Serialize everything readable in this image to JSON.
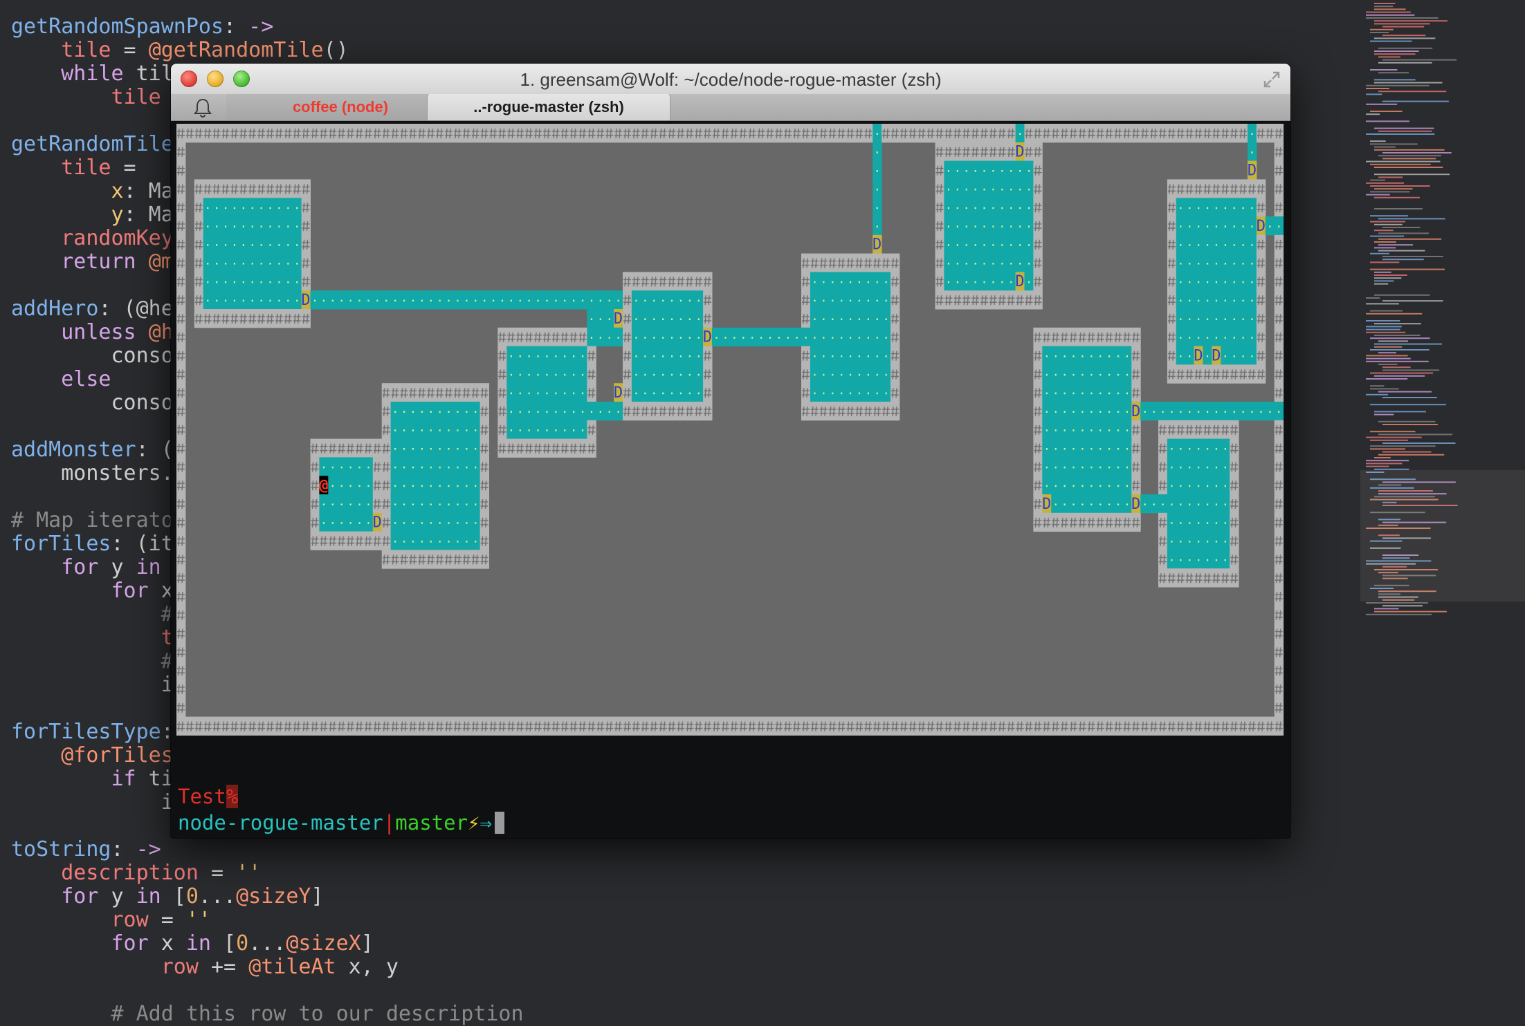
{
  "window": {
    "title": "1. greensam@Wolf: ~/code/node-rogue-master (zsh)",
    "tabs": [
      {
        "label": "coffee (node)",
        "state": "alert"
      },
      {
        "label": "..-rogue-master (zsh)",
        "state": "active"
      }
    ]
  },
  "map": {
    "wall_glyph": "#",
    "floor_glyph": ".",
    "door_glyph": "D",
    "hero_glyph": "@",
    "colors": {
      "floor": "#12a8a7",
      "wall": "#b5b5b5",
      "void": "#686868",
      "door": "#2b3fd0",
      "door_bg": "#c7b23a",
      "hero": "#ff3322",
      "hero_bg": "#000000",
      "dots": "#c6f39a"
    }
  },
  "terminal": {
    "output_line": "Test",
    "output_marker": "%",
    "prompt_dir": "node-rogue-master",
    "prompt_sep": "|",
    "prompt_branch": "master",
    "prompt_bolt": "⚡",
    "prompt_arrow": "⇒"
  },
  "editor": {
    "lines": [
      [
        [
          "fn",
          "getRandomSpawnPos"
        ],
        [
          "plain",
          ": "
        ],
        [
          "kw",
          "->"
        ]
      ],
      [
        [
          "plain",
          "    "
        ],
        [
          "var",
          "tile"
        ],
        [
          "plain",
          " = "
        ],
        [
          "at",
          "@getRandomTile"
        ],
        [
          "plain",
          "()"
        ]
      ],
      [
        [
          "plain",
          "    "
        ],
        [
          "kw",
          "while"
        ],
        [
          "plain",
          " tile"
        ]
      ],
      [
        [
          "plain",
          "        "
        ],
        [
          "var",
          "tile"
        ],
        [
          "plain",
          " ="
        ]
      ],
      [],
      [
        [
          "fn",
          "getRandomTile"
        ],
        [
          "plain",
          ":"
        ]
      ],
      [
        [
          "plain",
          "    "
        ],
        [
          "var",
          "tile"
        ],
        [
          "plain",
          " ="
        ]
      ],
      [
        [
          "plain",
          "        "
        ],
        [
          "str",
          "x"
        ],
        [
          "plain",
          ": Math"
        ]
      ],
      [
        [
          "plain",
          "        "
        ],
        [
          "str",
          "y"
        ],
        [
          "plain",
          ": Math"
        ]
      ],
      [
        [
          "plain",
          "    "
        ],
        [
          "var",
          "randomKey"
        ],
        [
          "plain",
          " ="
        ]
      ],
      [
        [
          "plain",
          "    "
        ],
        [
          "kw",
          "return"
        ],
        [
          "plain",
          " "
        ],
        [
          "at",
          "@map"
        ]
      ],
      [],
      [
        [
          "fn",
          "addHero"
        ],
        [
          "plain",
          ": (@hero"
        ]
      ],
      [
        [
          "plain",
          "    "
        ],
        [
          "kw",
          "unless"
        ],
        [
          "plain",
          " "
        ],
        [
          "at",
          "@her"
        ]
      ],
      [
        [
          "plain",
          "        console"
        ]
      ],
      [
        [
          "plain",
          "    "
        ],
        [
          "kw",
          "else"
        ]
      ],
      [
        [
          "plain",
          "        console"
        ]
      ],
      [],
      [
        [
          "fn",
          "addMonster"
        ],
        [
          "plain",
          ": (mo"
        ]
      ],
      [
        [
          "plain",
          "    monsters.pu"
        ]
      ],
      [],
      [
        [
          "cmt",
          "# Map iterator"
        ]
      ],
      [
        [
          "fn",
          "forTiles"
        ],
        [
          "plain",
          ": (iter"
        ]
      ],
      [
        [
          "plain",
          "    "
        ],
        [
          "kw",
          "for"
        ],
        [
          "plain",
          " y "
        ],
        [
          "kw",
          "in"
        ],
        [
          "plain",
          " ["
        ]
      ],
      [
        [
          "plain",
          "        "
        ],
        [
          "kw",
          "for"
        ],
        [
          "plain",
          " x "
        ]
      ],
      [
        [
          "plain",
          "            "
        ],
        [
          "cmt",
          "# C"
        ]
      ],
      [
        [
          "plain",
          "            "
        ],
        [
          "var",
          "til"
        ]
      ],
      [
        [
          "plain",
          "            "
        ],
        [
          "cmt",
          "# C"
        ]
      ],
      [
        [
          "plain",
          "            ite"
        ]
      ],
      [],
      [
        [
          "fn",
          "forTilesType"
        ],
        [
          "plain",
          ":"
        ]
      ],
      [
        [
          "plain",
          "    "
        ],
        [
          "at",
          "@forTiles"
        ]
      ],
      [
        [
          "plain",
          "        "
        ],
        [
          "kw",
          "if"
        ],
        [
          "plain",
          " tile"
        ]
      ],
      [
        [
          "plain",
          "            ite"
        ]
      ],
      [],
      [
        [
          "fn",
          "toString"
        ],
        [
          "plain",
          ": "
        ],
        [
          "kw",
          "->"
        ]
      ],
      [
        [
          "plain",
          "    "
        ],
        [
          "var",
          "description"
        ],
        [
          "plain",
          " = "
        ],
        [
          "str",
          "''"
        ]
      ],
      [
        [
          "plain",
          "    "
        ],
        [
          "kw",
          "for"
        ],
        [
          "plain",
          " y "
        ],
        [
          "kw",
          "in"
        ],
        [
          "plain",
          " ["
        ],
        [
          "num",
          "0"
        ],
        [
          "plain",
          "..."
        ],
        [
          "at",
          "@sizeY"
        ],
        [
          "plain",
          "]"
        ]
      ],
      [
        [
          "plain",
          "        "
        ],
        [
          "var",
          "row"
        ],
        [
          "plain",
          " = "
        ],
        [
          "str",
          "''"
        ]
      ],
      [
        [
          "plain",
          "        "
        ],
        [
          "kw",
          "for"
        ],
        [
          "plain",
          " x "
        ],
        [
          "kw",
          "in"
        ],
        [
          "plain",
          " ["
        ],
        [
          "num",
          "0"
        ],
        [
          "plain",
          "..."
        ],
        [
          "at",
          "@sizeX"
        ],
        [
          "plain",
          "]"
        ]
      ],
      [
        [
          "plain",
          "            "
        ],
        [
          "var",
          "row"
        ],
        [
          "plain",
          " += "
        ],
        [
          "at",
          "@tileAt"
        ],
        [
          "plain",
          " x, y"
        ]
      ],
      [],
      [
        [
          "plain",
          "        "
        ],
        [
          "cmt",
          "# Add this row to our description"
        ]
      ]
    ]
  }
}
